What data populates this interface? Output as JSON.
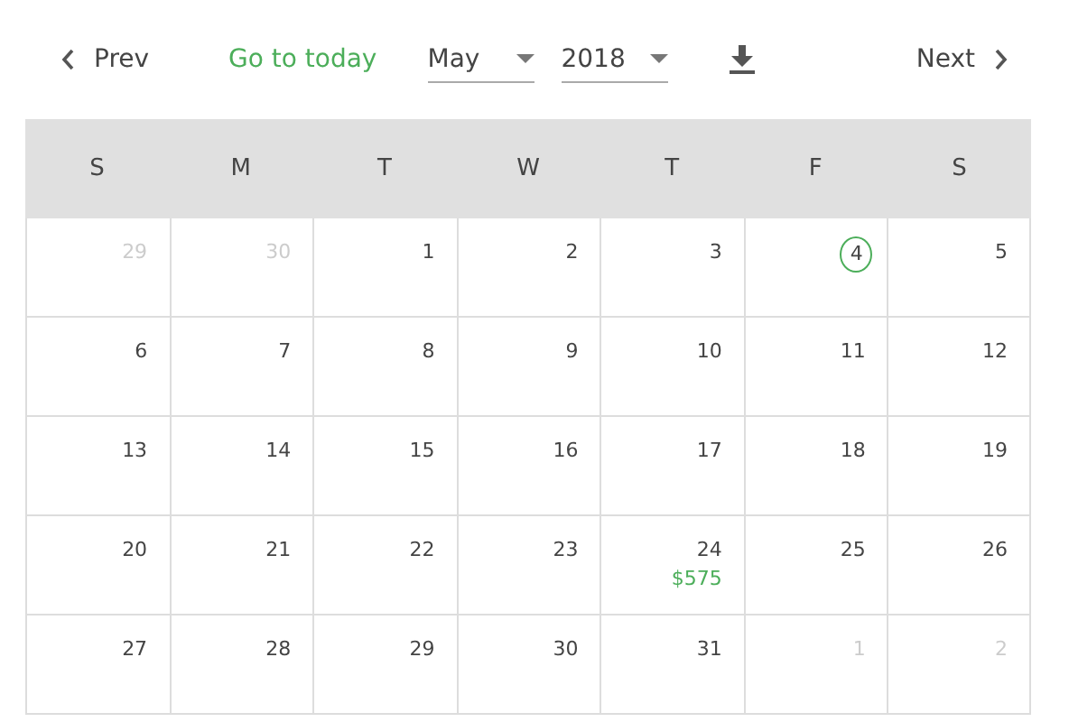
{
  "toolbar": {
    "prev": "Prev",
    "today": "Go to today",
    "month": "May",
    "year": "2018",
    "next": "Next"
  },
  "weekdays": [
    "S",
    "M",
    "T",
    "W",
    "T",
    "F",
    "S"
  ],
  "weeks": [
    [
      {
        "day": "29",
        "muted": true,
        "today": false
      },
      {
        "day": "30",
        "muted": true,
        "today": false
      },
      {
        "day": "1",
        "muted": false,
        "today": false
      },
      {
        "day": "2",
        "muted": false,
        "today": false
      },
      {
        "day": "3",
        "muted": false,
        "today": false
      },
      {
        "day": "4",
        "muted": false,
        "today": true
      },
      {
        "day": "5",
        "muted": false,
        "today": false
      }
    ],
    [
      {
        "day": "6",
        "muted": false,
        "today": false
      },
      {
        "day": "7",
        "muted": false,
        "today": false
      },
      {
        "day": "8",
        "muted": false,
        "today": false
      },
      {
        "day": "9",
        "muted": false,
        "today": false
      },
      {
        "day": "10",
        "muted": false,
        "today": false
      },
      {
        "day": "11",
        "muted": false,
        "today": false
      },
      {
        "day": "12",
        "muted": false,
        "today": false
      }
    ],
    [
      {
        "day": "13",
        "muted": false,
        "today": false
      },
      {
        "day": "14",
        "muted": false,
        "today": false
      },
      {
        "day": "15",
        "muted": false,
        "today": false
      },
      {
        "day": "16",
        "muted": false,
        "today": false
      },
      {
        "day": "17",
        "muted": false,
        "today": false
      },
      {
        "day": "18",
        "muted": false,
        "today": false
      },
      {
        "day": "19",
        "muted": false,
        "today": false
      }
    ],
    [
      {
        "day": "20",
        "muted": false,
        "today": false
      },
      {
        "day": "21",
        "muted": false,
        "today": false
      },
      {
        "day": "22",
        "muted": false,
        "today": false
      },
      {
        "day": "23",
        "muted": false,
        "today": false
      },
      {
        "day": "24",
        "muted": false,
        "today": false,
        "amount": "$575"
      },
      {
        "day": "25",
        "muted": false,
        "today": false
      },
      {
        "day": "26",
        "muted": false,
        "today": false
      }
    ],
    [
      {
        "day": "27",
        "muted": false,
        "today": false
      },
      {
        "day": "28",
        "muted": false,
        "today": false
      },
      {
        "day": "29",
        "muted": false,
        "today": false
      },
      {
        "day": "30",
        "muted": false,
        "today": false
      },
      {
        "day": "31",
        "muted": false,
        "today": false
      },
      {
        "day": "1",
        "muted": true,
        "today": false
      },
      {
        "day": "2",
        "muted": true,
        "today": false
      }
    ]
  ]
}
